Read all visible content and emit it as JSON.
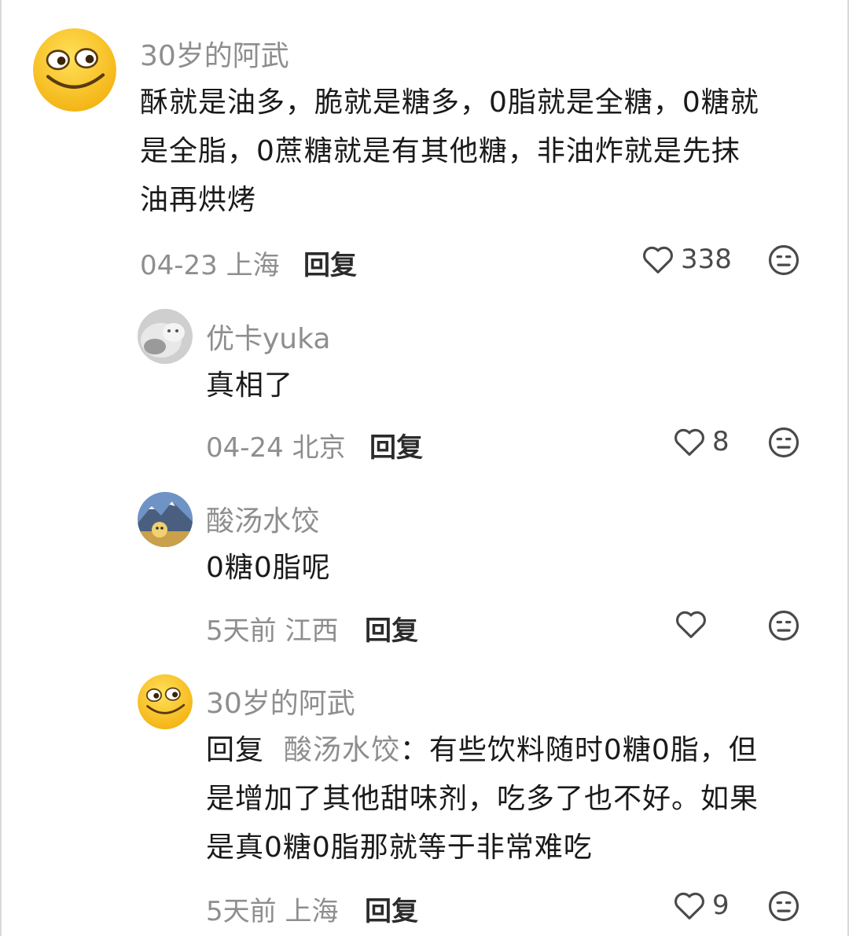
{
  "comments": [
    {
      "username": "30岁的阿武",
      "lines": [
        "酥就是油多，脆就是糖多，0脂就是全糖，0糖就",
        "是全脂，0蔗糖就是有其他糖，非油炸就是先抹",
        "油再烘烤"
      ],
      "meta": "04-23 上海",
      "reply_label": "回复",
      "likes": "338",
      "avatar": "smiley-emoji"
    },
    {
      "username": "优卡yuka",
      "lines": [
        "真相了"
      ],
      "meta": "04-24 北京",
      "reply_label": "回复",
      "likes": "8",
      "avatar": "cat-photo"
    },
    {
      "username": "酸汤水饺",
      "lines": [
        "0糖0脂呢"
      ],
      "meta": "5天前 江西",
      "reply_label": "回复",
      "likes": "",
      "avatar": "mountain-photo"
    },
    {
      "username": "30岁的阿武",
      "reply_prefix": "回复",
      "reply_target": "酸汤水饺",
      "reply_first_line_rest": "：有些饮料随时0糖0脂，但",
      "lines": [
        "是增加了其他甜味剂，吃多了也不好。如果",
        "是真0糖0脂那就等于非常难吃"
      ],
      "meta": "5天前 上海",
      "reply_label": "回复",
      "likes": "9",
      "avatar": "smiley-emoji"
    }
  ],
  "icons": {
    "like": "heart-outline-icon",
    "dislike": "meh-face-icon"
  },
  "colors": {
    "text": "#1a1a1a",
    "muted": "#8e8e8e",
    "emoji_yellow": "#f7c51c"
  }
}
